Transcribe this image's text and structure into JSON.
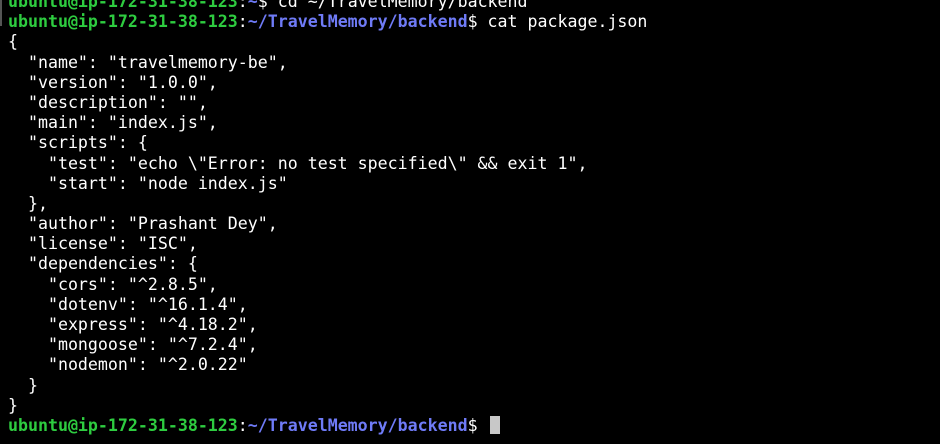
{
  "terminal": {
    "prev_prompt": {
      "user": "ubuntu@ip-172-31-38-123",
      "sep": ":",
      "path": "~",
      "suffix": "$ cd ~/TravelMemory/backend"
    },
    "cmd_prompt": {
      "user": "ubuntu@ip-172-31-38-123",
      "sep": ":",
      "path": "~/TravelMemory/backend",
      "suffix": "$ cat package.json"
    },
    "output": [
      "{",
      "  \"name\": \"travelmemory-be\",",
      "  \"version\": \"1.0.0\",",
      "  \"description\": \"\",",
      "  \"main\": \"index.js\",",
      "  \"scripts\": {",
      "    \"test\": \"echo \\\"Error: no test specified\\\" && exit 1\",",
      "    \"start\": \"node index.js\"",
      "  },",
      "  \"author\": \"Prashant Dey\",",
      "  \"license\": \"ISC\",",
      "  \"dependencies\": {",
      "    \"cors\": \"^2.8.5\",",
      "    \"dotenv\": \"^16.1.4\",",
      "    \"express\": \"^4.18.2\",",
      "    \"mongoose\": \"^7.2.4\",",
      "    \"nodemon\": \"^2.0.22\"",
      "  }",
      "}"
    ],
    "final_prompt": {
      "user": "ubuntu@ip-172-31-38-123",
      "sep": ":",
      "path": "~/TravelMemory/backend",
      "suffix": "$ "
    }
  },
  "colors": {
    "background": "#000000",
    "user": "#2ecc40",
    "path": "#6f7bf7",
    "text": "#ffffff",
    "cursor": "#c8c8c8"
  }
}
